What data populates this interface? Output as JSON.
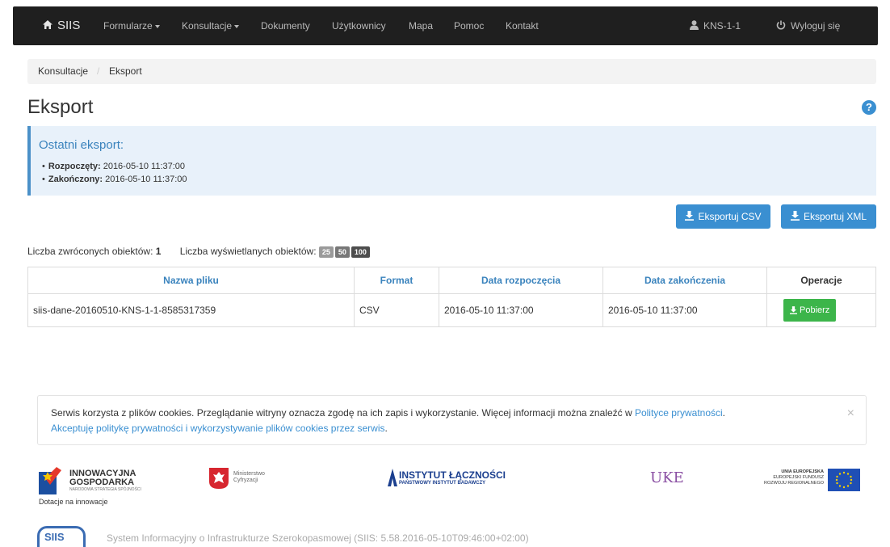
{
  "navbar": {
    "brand": "SIIS",
    "items": [
      "Formularze",
      "Konsultacje",
      "Dokumenty",
      "Użytkownicy",
      "Mapa",
      "Pomoc",
      "Kontakt"
    ],
    "user": "KNS-1-1",
    "logout": "Wyloguj się"
  },
  "breadcrumb": {
    "parent": "Konsultacje",
    "separator": "/",
    "current": "Eksport"
  },
  "page_title": "Eksport",
  "help_icon": "?",
  "info": {
    "heading": "Ostatni eksport:",
    "started_label": "Rozpoczęty:",
    "started_value": "2016-05-10 11:37:00",
    "finished_label": "Zakończony:",
    "finished_value": "2016-05-10 11:37:00"
  },
  "buttons": {
    "export_csv": "Eksportuj CSV",
    "export_xml": "Eksportuj XML"
  },
  "counts": {
    "returned_label": "Liczba zwróconych obiektów:",
    "returned_value": "1",
    "displayed_label": "Liczba wyświetlanych obiektów:",
    "page_sizes": [
      "25",
      "50",
      "100"
    ]
  },
  "table": {
    "headers": [
      "Nazwa pliku",
      "Format",
      "Data rozpoczęcia",
      "Data zakończenia",
      "Operacje"
    ],
    "rows": [
      {
        "file": "siis-dane-20160510-KNS-1-1-8585317359",
        "format": "CSV",
        "start": "2016-05-10 11:37:00",
        "end": "2016-05-10 11:37:00",
        "action": "Pobierz"
      }
    ]
  },
  "cookie": {
    "text": "Serwis korzysta z plików cookies. Przeglądanie witryny oznacza zgodę na ich zapis i wykorzystanie. Więcej informacji można znaleźć w ",
    "policy_link": "Polityce prywatności",
    "period": ".",
    "accept_link": "Akceptuję politykę prywatności i wykorzystywanie plików cookies przez serwis",
    "close": "×"
  },
  "logos": {
    "ig_line1": "INNOWACYJNA",
    "ig_line2": "GOSPODARKA",
    "ig_line3": "NARODOWA STRATEGIA SPÓJNOŚCI",
    "ig_caption": "Dotacje na innowacje",
    "mc_line1": "Ministerstwo",
    "mc_line2": "Cyfryzacji",
    "il_title": "INSTYTUT ŁĄCZNOŚCI",
    "il_subtitle": "PAŃSTWOWY INSTYTUT BADAWCZY",
    "uke": "UKE",
    "ue_line1": "UNIA EUROPEJSKA",
    "ue_line2": "EUROPEJSKI FUNDUSZ",
    "ue_line3": "ROZWOJU REGIONALNEGO"
  },
  "footer": {
    "logo": "SIIS",
    "text": "System Informacyjny o Infrastrukturze Szerokopasmowej  (SIIS: 5.58.2016-05-10T09:46:00+02:00)"
  },
  "colors": {
    "accent": "#3a8fd1",
    "success": "#3cb54a",
    "navbar": "#1f1f1f"
  }
}
